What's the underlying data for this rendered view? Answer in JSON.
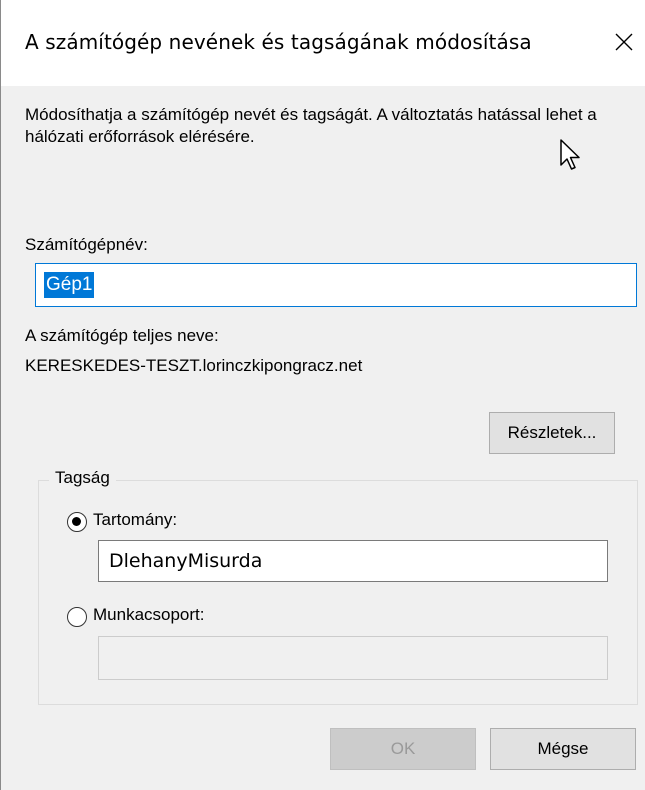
{
  "dialog": {
    "title": "A számítógép nevének és tagságának módosítása",
    "description": "Módosíthatja a számítógép nevét és tagságát. A változtatás hatással lehet a hálózati erőforrások elérésére.",
    "computer_name_label": "Számítógépnév:",
    "computer_name_value": "Gép1",
    "full_name_label": "A számítógép teljes neve:",
    "full_name_value": "KERESKEDES-TESZT.lorinczkipongracz.net",
    "details_button": "Részletek...",
    "membership": {
      "legend": "Tagság",
      "domain_label": "Tartomány:",
      "domain_value": "DlehanyMisurda",
      "domain_selected": true,
      "workgroup_label": "Munkacsoport:",
      "workgroup_value": ""
    },
    "ok_button": "OK",
    "cancel_button": "Mégse"
  },
  "icons": {
    "close": "close-icon",
    "cursor": "mouse-pointer-icon"
  },
  "colors": {
    "selection": "#0078d7",
    "dialog_bg": "#f0f0f0",
    "titlebar_bg": "#ffffff"
  }
}
